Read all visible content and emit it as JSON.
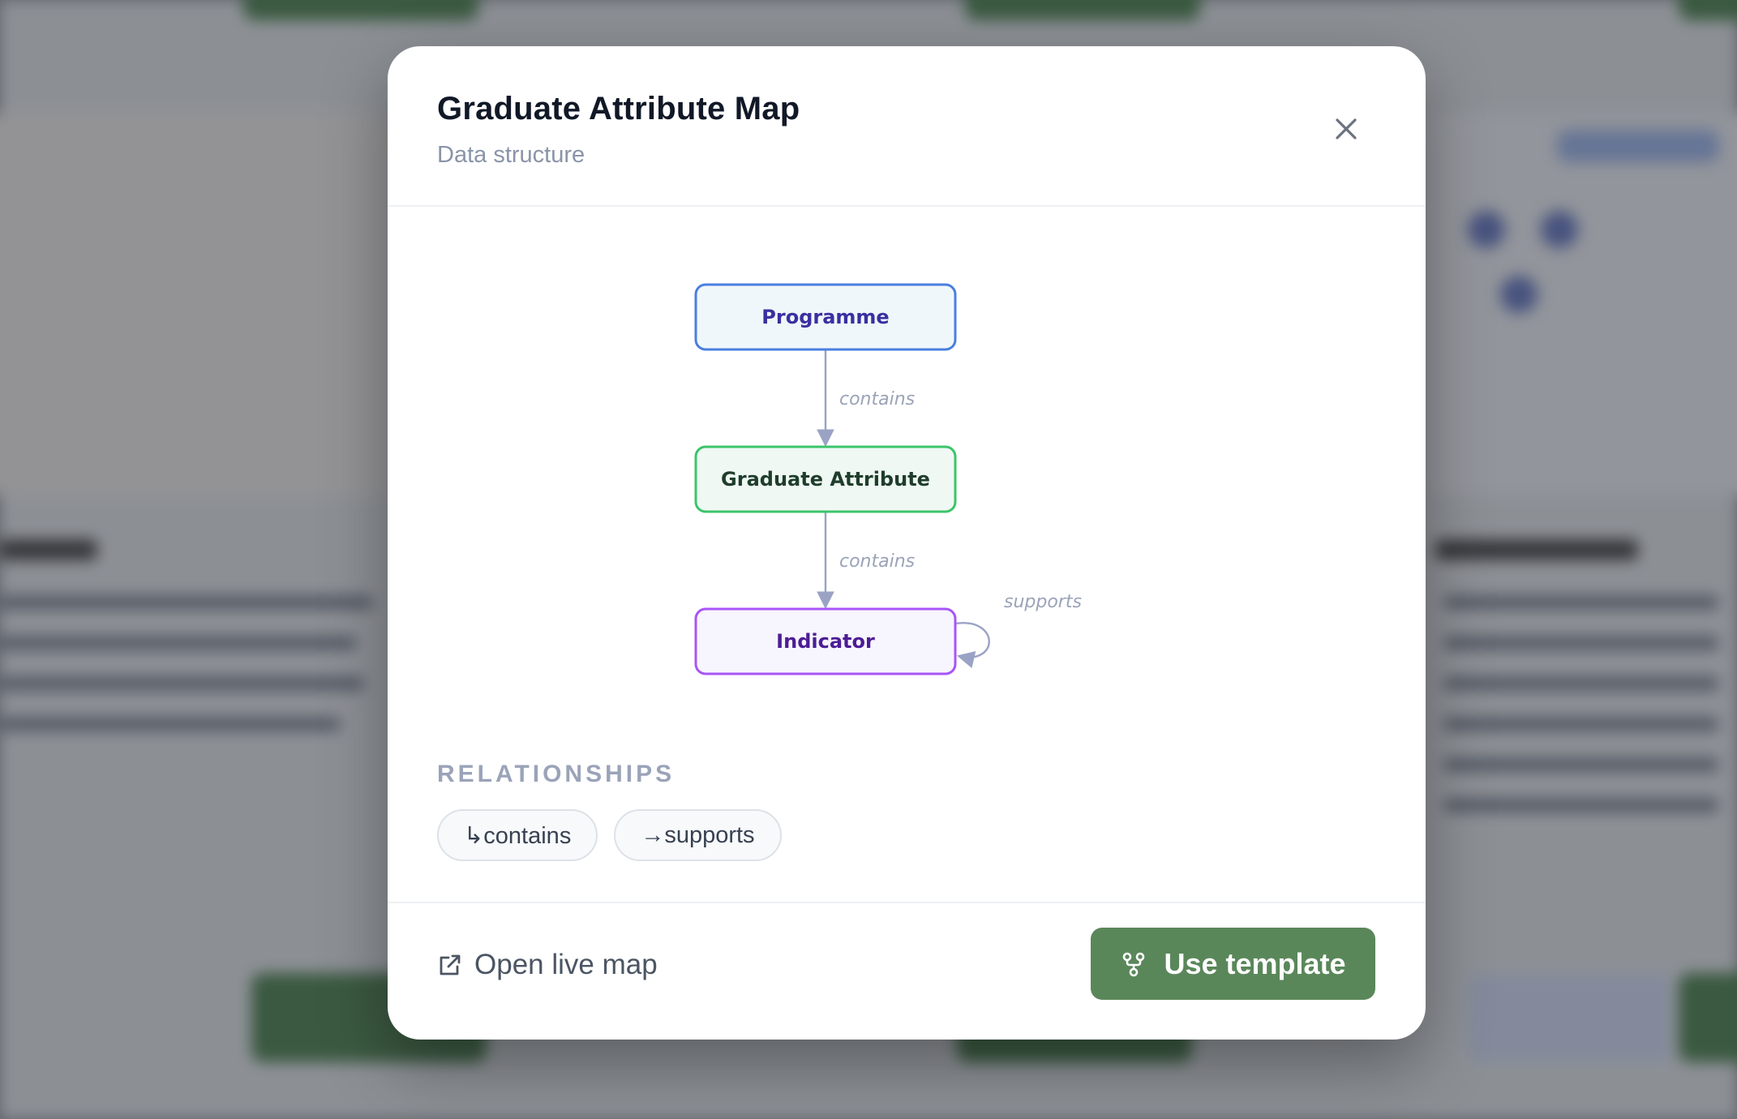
{
  "modal": {
    "title": "Graduate Attribute Map",
    "subtitle": "Data structure",
    "close_icon": "close-icon"
  },
  "diagram": {
    "nodes": [
      {
        "id": "programme",
        "label": "Programme",
        "border": "#4a7fe0",
        "fill": "#f0f7fa",
        "text": "#3b2fa0"
      },
      {
        "id": "graduate-attribute",
        "label": "Graduate Attribute",
        "border": "#3cc46a",
        "fill": "#eff8f3",
        "text": "#1f3d2b"
      },
      {
        "id": "indicator",
        "label": "Indicator",
        "border": "#a855f7",
        "fill": "#f7f5fd",
        "text": "#4c1d95"
      }
    ],
    "edges": [
      {
        "from": "programme",
        "to": "graduate-attribute",
        "label": "contains"
      },
      {
        "from": "graduate-attribute",
        "to": "indicator",
        "label": "contains"
      },
      {
        "from": "indicator",
        "to": "indicator",
        "label": "supports"
      }
    ]
  },
  "relationships": {
    "heading": "RELATIONSHIPS",
    "items": [
      {
        "label": "↳contains"
      },
      {
        "label": "→supports"
      }
    ]
  },
  "footer": {
    "open_link_label": "Open live map",
    "open_link_icon": "external-link-icon",
    "use_button_label": "Use template",
    "use_button_icon": "fork-icon",
    "accent_color": "#5a875a"
  }
}
